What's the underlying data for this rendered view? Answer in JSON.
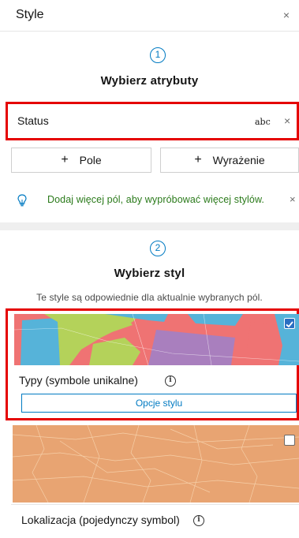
{
  "header": {
    "title": "Style",
    "close_glyph": "×"
  },
  "step1": {
    "number": "1",
    "title": "Wybierz atrybuty"
  },
  "attribute": {
    "name": "Status",
    "type_label": "abc",
    "remove_glyph": "×"
  },
  "buttons": {
    "plus_glyph": "+",
    "field_label": "Pole",
    "expression_label": "Wyrażenie"
  },
  "tip": {
    "text": "Dodaj więcej pól, aby wypróbować więcej stylów.",
    "close_glyph": "×",
    "icon": "lightbulb-icon"
  },
  "step2": {
    "number": "2",
    "title": "Wybierz styl",
    "subtitle": "Te style są odpowiednie dla aktualnie wybranych pól."
  },
  "styles": [
    {
      "label": "Typy (symbole unikalne)",
      "checked": true,
      "options_label": "Opcje stylu",
      "info_glyph": "i"
    },
    {
      "label": "Lokalizacja (pojedynczy symbol)",
      "checked": false,
      "info_glyph": "i"
    }
  ],
  "colors": {
    "accent": "#007ac2",
    "tip_green": "#2a7a1a",
    "highlight_red": "#e50000",
    "map_red": "#ef7373",
    "map_blue": "#56b3d9",
    "map_green": "#b4d25a",
    "map_purple": "#a97fbe",
    "map_orange": "#e8a472"
  }
}
